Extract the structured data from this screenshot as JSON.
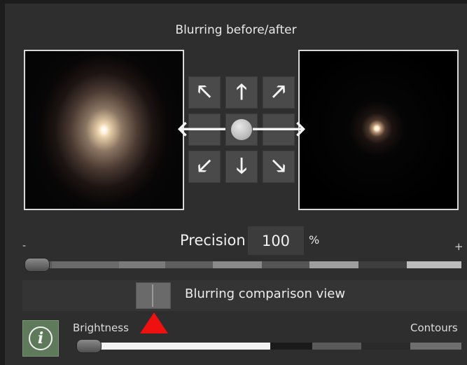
{
  "title": "Blurring before/after",
  "precision": {
    "label": "Precision",
    "value": "100",
    "unit": "%"
  },
  "slider": {
    "min_label": "-",
    "max_label": "+"
  },
  "comparison": {
    "label": "Blurring comparison view"
  },
  "bottom": {
    "left_label": "Brightness",
    "right_label": "Contours"
  },
  "arrows": {
    "up_left": "🡔",
    "up": "🡑",
    "up_right": "🡕",
    "left": "🡐",
    "right": "🡒",
    "down_left": "🡗",
    "down": "🡓",
    "down_right": "🡖"
  }
}
